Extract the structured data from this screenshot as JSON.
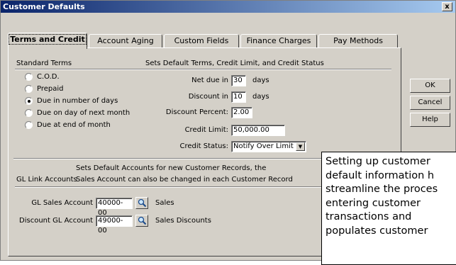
{
  "window": {
    "title": "Customer Defaults",
    "close_label": "x"
  },
  "tabs": [
    {
      "label": "Terms and Credit"
    },
    {
      "label": "Account Aging"
    },
    {
      "label": "Custom Fields"
    },
    {
      "label": "Finance Charges"
    },
    {
      "label": "Pay Methods"
    }
  ],
  "standard_terms": {
    "header": "Standard Terms",
    "description": "Sets Default Terms, Credit Limit, and Credit Status",
    "options": [
      {
        "label": "C.O.D.",
        "selected": false
      },
      {
        "label": "Prepaid",
        "selected": false
      },
      {
        "label": "Due in number of days",
        "selected": true
      },
      {
        "label": "Due on day of next month",
        "selected": false
      },
      {
        "label": "Due at end of month",
        "selected": false
      }
    ],
    "net_due": {
      "label": "Net due in",
      "value": "30",
      "unit": "days"
    },
    "discount_in": {
      "label": "Discount in",
      "value": "10",
      "unit": "days"
    },
    "discount_percent": {
      "label": "Discount Percent:",
      "value": "2.00"
    },
    "credit_limit": {
      "label": "Credit Limit:",
      "value": "50,000.00"
    },
    "credit_status": {
      "label": "Credit Status:",
      "value": "Notify Over Limit"
    }
  },
  "gl_link": {
    "header": "GL Link Accounts",
    "description_line1": "Sets Default Accounts for new Customer Records, the",
    "description_line2": "Sales Account can also be changed in each Customer Record",
    "sales_account": {
      "label": "GL Sales Account",
      "value": "40000-00",
      "desc": "Sales"
    },
    "discount_account": {
      "label": "Discount GL Account",
      "value": "49000-00",
      "desc": "Sales Discounts"
    }
  },
  "buttons": {
    "ok": "OK",
    "cancel": "Cancel",
    "help": "Help"
  },
  "note": {
    "text": "Setting up customer\ndefault information h\nstreamline the proces\nentering customer\ntransactions and\npopulates customer"
  }
}
